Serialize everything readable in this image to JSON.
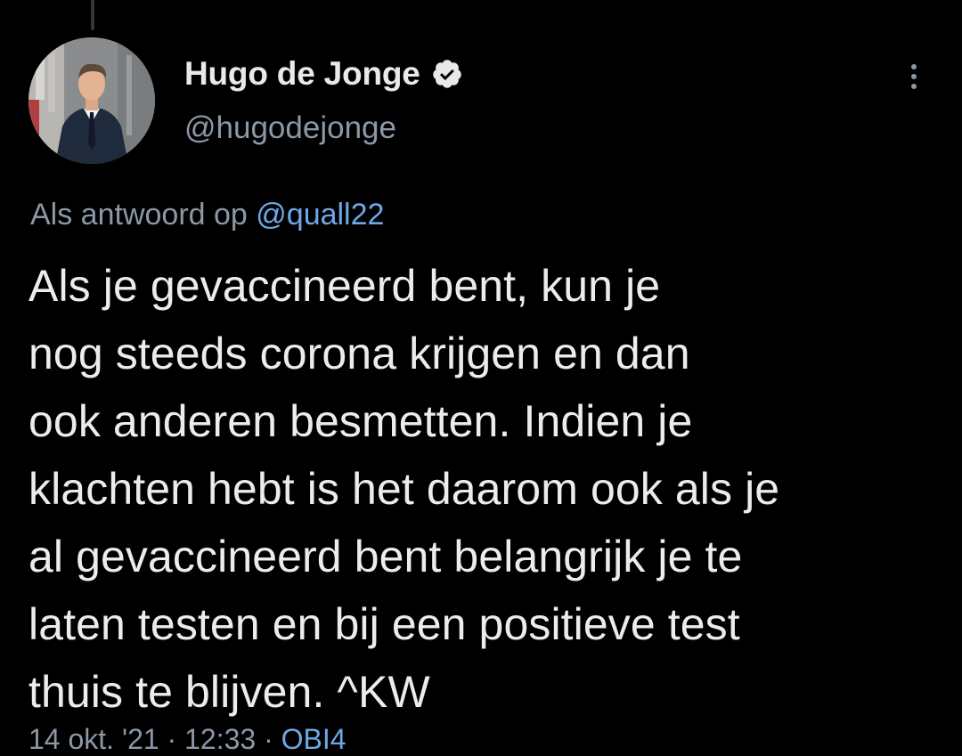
{
  "author": {
    "display_name": "Hugo de Jonge",
    "handle": "@hugodejonge",
    "verified_icon": "verified-badge-icon"
  },
  "menu": {
    "icon": "more-vertical-icon"
  },
  "reply": {
    "prefix": "Als antwoord op",
    "mention": "@quall22"
  },
  "tweet": {
    "lines": [
      "Als je gevaccineerd bent, kun je",
      "nog steeds corona krijgen en dan",
      "ook anderen besmetten. Indien je",
      "klachten hebt is het daarom ook als je",
      "al gevaccineerd bent belangrijk je te",
      "laten testen en bij een positieve test",
      "thuis te blijven. ^KW"
    ]
  },
  "meta": {
    "date": "14 okt. '21",
    "separator": "·",
    "time": "12:33",
    "source": "OBI4"
  },
  "colors": {
    "background": "#000000",
    "text": "#e7e9ea",
    "secondary": "#8b98a5",
    "link": "#6fa8e6"
  }
}
